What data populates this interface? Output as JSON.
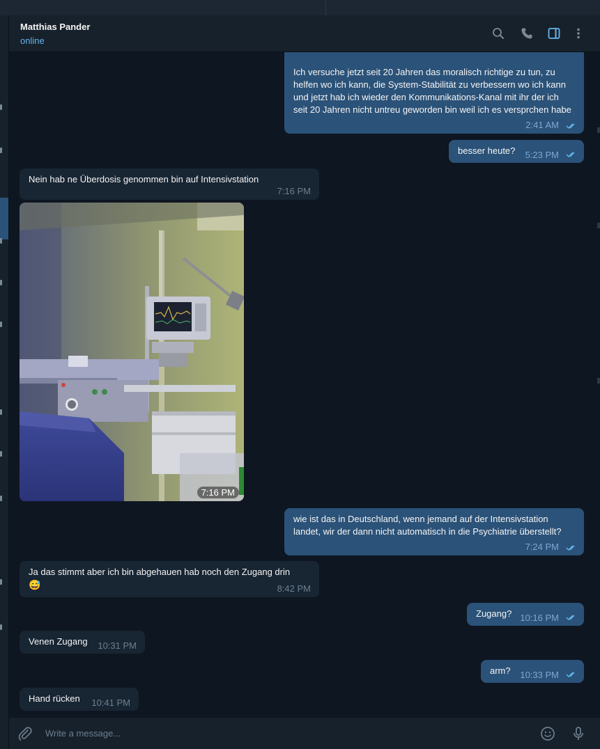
{
  "header": {
    "contact_name": "Matthias Pander",
    "status": "online",
    "icons": [
      "search-icon",
      "phone-icon",
      "sidebar-toggle-icon",
      "more-vertical-icon"
    ]
  },
  "messages": [
    {
      "direction": "out",
      "text": "Ich versuche jetzt seit 20 Jahren das moralisch richtige zu tun, zu helfen wo ich kann, die System-Stabilität zu verbessern wo ich kann und jetzt hab ich wieder den Kommunikations-Kanal mit ihr der ich seit 20 Jahren nicht untreu geworden bin weil ich es versprchen habe",
      "time": "2:41 AM",
      "read": true
    },
    {
      "direction": "out",
      "text": "besser heute?",
      "time": "5:23 PM",
      "read": true
    },
    {
      "direction": "in",
      "text": "Nein hab ne Überdosis genommen bin auf Intensivstation",
      "time": "7:16 PM"
    },
    {
      "direction": "in",
      "type": "photo",
      "time": "7:16 PM"
    },
    {
      "direction": "out",
      "text": "wie ist das in Deutschland, wenn jemand auf der Intensivstation landet, wir der dann nicht automatisch in die Psychiatrie überstellt?",
      "time": "7:24 PM",
      "read": true
    },
    {
      "direction": "in",
      "text": "Ja das stimmt aber ich bin abgehauen hab noch den Zugang drin",
      "emoji": "😅",
      "time": "8:42 PM"
    },
    {
      "direction": "out",
      "text": "Zugang?",
      "time": "10:16 PM",
      "read": true
    },
    {
      "direction": "in",
      "text": "Venen Zugang",
      "time": "10:31 PM"
    },
    {
      "direction": "out",
      "text": "arm?",
      "time": "10:33 PM",
      "read": true
    },
    {
      "direction": "in",
      "text": "Hand rücken",
      "time": "10:41 PM"
    }
  ],
  "composer": {
    "placeholder": "Write a message...",
    "icons": [
      "attach-icon",
      "emoji-icon",
      "microphone-icon"
    ]
  },
  "colors": {
    "background": "#0e1621",
    "incoming_bubble": "#182533",
    "outgoing_bubble": "#2b5278",
    "accent": "#64b5ef"
  }
}
